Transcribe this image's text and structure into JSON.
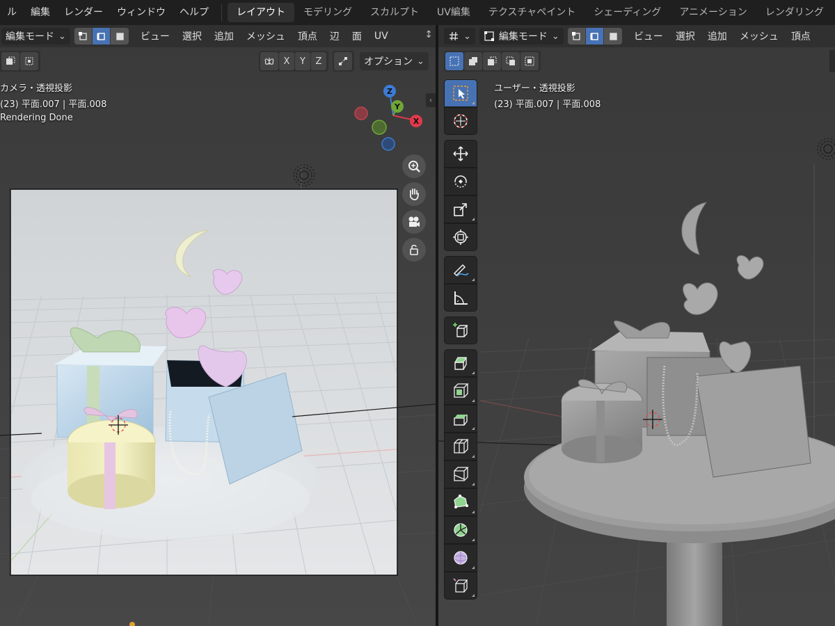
{
  "menu": {
    "items": [
      "ル",
      "編集",
      "レンダー",
      "ウィンドウ",
      "ヘルプ"
    ]
  },
  "workspaces": {
    "tabs": [
      "レイアウト",
      "モデリング",
      "スカルプト",
      "UV編集",
      "テクスチャペイント",
      "シェーディング",
      "アニメーション",
      "レンダリング"
    ],
    "active": "レイアウト"
  },
  "left_viewport": {
    "header": {
      "mode": "編集モード",
      "menus": [
        "ビュー",
        "選択",
        "追加",
        "メッシュ",
        "頂点",
        "辺",
        "面",
        "UV"
      ]
    },
    "sub": {
      "axes": [
        "X",
        "Y",
        "Z"
      ],
      "options": "オプション"
    },
    "overlay": {
      "view_name": "カメラ・透視投影",
      "object_info": "(23) 平面.007 | 平面.008",
      "status": "Rendering Done"
    },
    "gizmo": {
      "z": "Z",
      "y": "Y",
      "x": "X"
    }
  },
  "right_viewport": {
    "header": {
      "mode": "編集モード",
      "menus": [
        "ビュー",
        "選択",
        "追加",
        "メッシュ",
        "頂点"
      ]
    },
    "overlay": {
      "view_name": "ユーザー・透視投影",
      "object_info": "(23) 平面.007 | 平面.008"
    }
  },
  "icons": {
    "zoom": "zoom-icon",
    "pan": "hand-icon",
    "camera": "camera-icon",
    "lock": "lock-icon",
    "toolbar": [
      "select-box-icon",
      "cursor-icon",
      "move-icon",
      "rotate-icon",
      "scale-icon",
      "transform-icon",
      "annotate-icon",
      "measure-icon",
      "add-cube-icon",
      "extrude-icon",
      "inset-icon",
      "bevel-icon",
      "loop-cut-icon",
      "knife-icon",
      "poly-build-icon",
      "spin-icon",
      "smooth-icon",
      "edge-slide-icon"
    ]
  },
  "colors": {
    "accent": "#4772b3",
    "axis_x": "#e0394a",
    "axis_y": "#70a637",
    "axis_z": "#3d7cd6"
  }
}
